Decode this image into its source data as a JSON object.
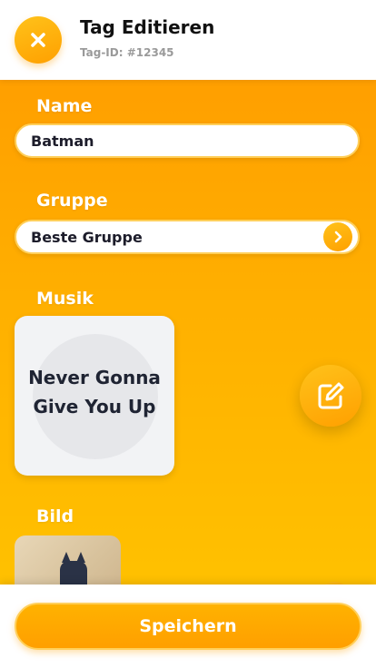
{
  "header": {
    "title": "Tag Editieren",
    "tag_id": "Tag-ID: #12345",
    "close_icon": "close-icon"
  },
  "form": {
    "name_label": "Name",
    "name_value": "Batman",
    "group_label": "Gruppe",
    "group_value": "Beste Gruppe",
    "music_label": "Musik",
    "music_title": "Never Gonna Give You Up",
    "image_label": "Bild"
  },
  "actions": {
    "save_label": "Speichern"
  },
  "colors": {
    "accent": "#ffa000",
    "accent_light": "#ffc21a",
    "text_dark": "#1c1c2a"
  }
}
